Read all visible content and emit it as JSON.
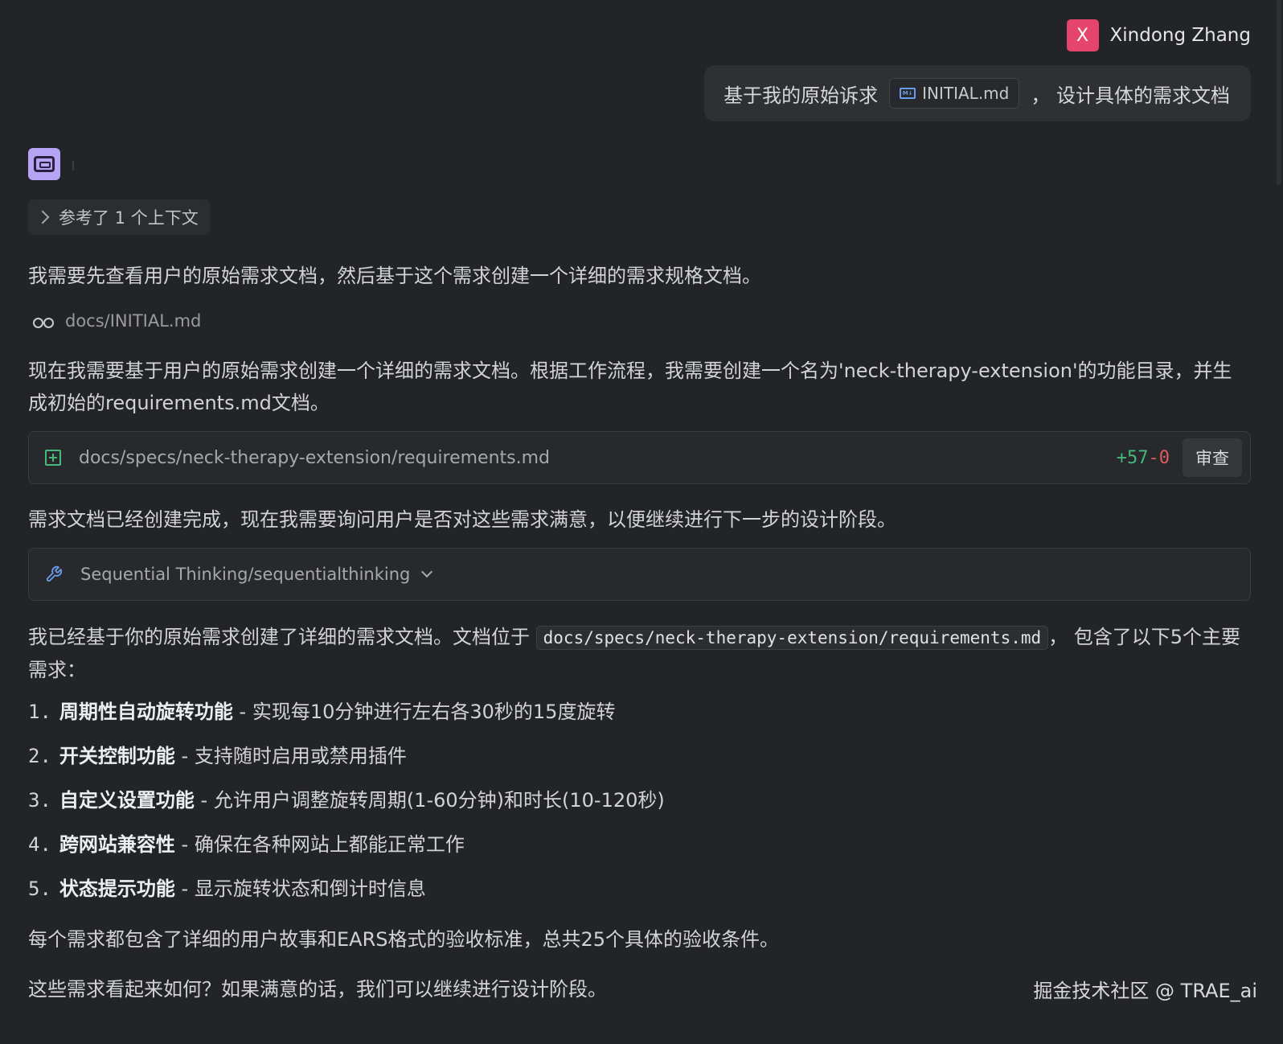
{
  "user": {
    "initial": "X",
    "name": "Xindong Zhang"
  },
  "prompt": {
    "before": "基于我的原始诉求",
    "file": "INITIAL.md",
    "after": "，  设计具体的需求文档"
  },
  "context_chip": "参考了 1 个上下文",
  "messages": {
    "p1": "我需要先查看用户的原始需求文档，然后基于这个需求创建一个详细的需求规格文档。",
    "read_file": "docs/INITIAL.md",
    "p2": "现在我需要基于用户的原始需求创建一个详细的需求文档。根据工作流程，我需要创建一个名为'neck-therapy-extension'的功能目录，并生成初始的requirements.md文档。",
    "p3": "需求文档已经创建完成，现在我需要询问用户是否对这些需求满意，以便继续进行下一步的设计阶段。",
    "p4_before": "我已经基于你的原始需求创建了详细的需求文档。文档位于 ",
    "p4_code": "docs/specs/neck-therapy-extension/requirements.md",
    "p4_after": "， 包含了以下5个主要需求：",
    "p5": "每个需求都包含了详细的用户故事和EARS格式的验收标准，总共25个具体的验收条件。",
    "p6": "这些需求看起来如何？如果满意的话，我们可以继续进行设计阶段。"
  },
  "file_card": {
    "path": "docs/specs/neck-therapy-extension/requirements.md",
    "added": "+57",
    "removed": "-0",
    "review_label": "审查"
  },
  "tool_card": {
    "label": "Sequential Thinking/sequentialthinking"
  },
  "requirements": [
    {
      "num": "1.",
      "title": "周期性自动旋转功能",
      "desc": " - 实现每10分钟进行左右各30秒的15度旋转"
    },
    {
      "num": "2.",
      "title": "开关控制功能",
      "desc": " - 支持随时启用或禁用插件"
    },
    {
      "num": "3.",
      "title": "自定义设置功能",
      "desc": " - 允许用户调整旋转周期(1-60分钟)和时长(10-120秒)"
    },
    {
      "num": "4.",
      "title": "跨网站兼容性",
      "desc": " - 确保在各种网站上都能正常工作"
    },
    {
      "num": "5.",
      "title": "状态提示功能",
      "desc": " - 显示旋转状态和倒计时信息"
    }
  ],
  "watermark": "掘金技术社区 @ TRAE_ai",
  "colors": {
    "background": "#232427",
    "avatar": "#e5456a",
    "bot_avatar": "#b4a4f3",
    "added": "#45b87a",
    "removed": "#e05d5d"
  },
  "icons": [
    "md-file-icon",
    "bot-avatar-icon",
    "chevron-right-icon",
    "glasses-icon",
    "file-add-icon",
    "wrench-icon",
    "chevron-down-icon"
  ]
}
